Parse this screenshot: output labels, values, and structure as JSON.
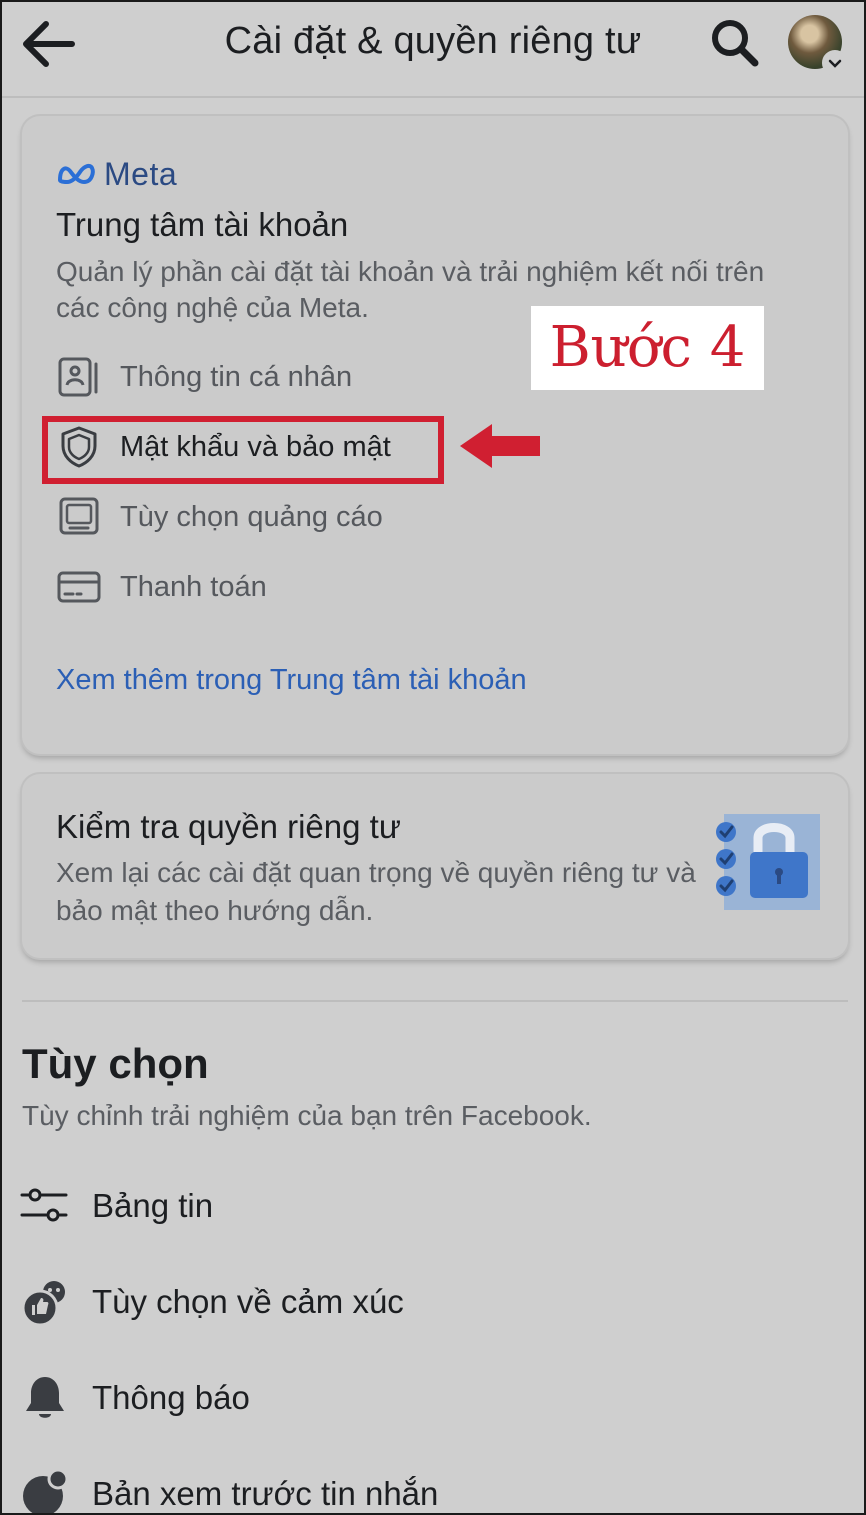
{
  "header": {
    "title": "Cài đặt & quyền riêng tư"
  },
  "accounts_center": {
    "brand": "Meta",
    "title": "Trung tâm tài khoản",
    "description": "Quản lý phần cài đặt tài khoản và trải nghiệm kết nối trên các công nghệ của Meta.",
    "items": [
      {
        "label": "Thông tin cá nhân",
        "icon": "id-card-icon"
      },
      {
        "label": "Mật khẩu và bảo mật",
        "icon": "shield-icon"
      },
      {
        "label": "Tùy chọn quảng cáo",
        "icon": "monitor-icon"
      },
      {
        "label": "Thanh toán",
        "icon": "credit-card-icon"
      }
    ],
    "link": "Xem thêm trong Trung tâm tài khoản"
  },
  "privacy_checkup": {
    "title": "Kiểm tra quyền riêng tư",
    "description": "Xem lại các cài đặt quan trọng về quyền riêng tư và bảo mật theo hướng dẫn."
  },
  "preferences": {
    "heading": "Tùy chọn",
    "subtitle": "Tùy chỉnh trải nghiệm của bạn trên Facebook.",
    "items": [
      {
        "label": "Bảng tin",
        "icon": "feed-sliders-icon"
      },
      {
        "label": "Tùy chọn về cảm xúc",
        "icon": "reactions-icon"
      },
      {
        "label": "Thông báo",
        "icon": "bell-icon"
      },
      {
        "label": "Bản xem trước tin nhắn",
        "icon": "message-preview-icon"
      }
    ]
  },
  "annotation": {
    "step_label": "Bước 4",
    "highlight_color": "#d01f31"
  },
  "colors": {
    "background": "#cfcfcf",
    "link": "#2b5fb5",
    "meta_blue": "#2b4a83",
    "accent_red": "#cc1f2f"
  }
}
